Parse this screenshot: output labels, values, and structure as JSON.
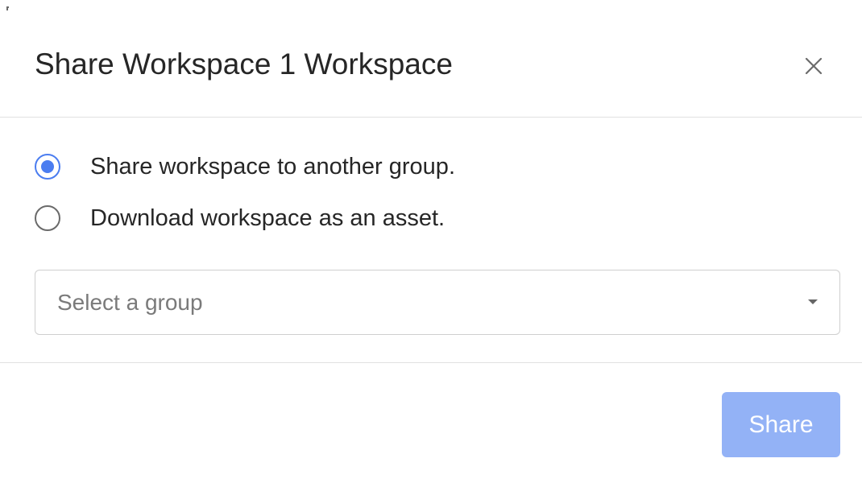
{
  "dialog": {
    "title": "Share Workspace 1 Workspace",
    "close_icon": "close-icon"
  },
  "options": {
    "share_to_group": {
      "label": "Share workspace to another group.",
      "checked": true
    },
    "download_as_asset": {
      "label": "Download workspace as an asset.",
      "checked": false
    }
  },
  "group_select": {
    "placeholder": "Select a group",
    "value": "",
    "caret_icon": "caret-down-icon"
  },
  "footer": {
    "share_label": "Share",
    "share_disabled": true
  },
  "colors": {
    "accent": "#4b7df0",
    "button_disabled_bg": "#93b2f6",
    "divider": "#e1e1e1"
  }
}
